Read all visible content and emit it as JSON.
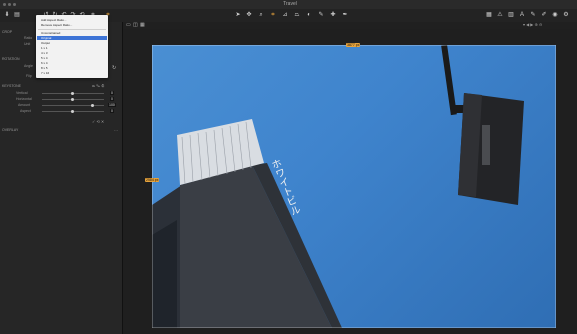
{
  "window": {
    "title": "Travel"
  },
  "aspect_menu": {
    "items_top": [
      "Add Aspect Ratio...",
      "Remove Aspect Ratio..."
    ],
    "items": [
      "Unconstrained",
      "Original",
      "Output",
      "1 x 1",
      "4 x 3",
      "5 x 4",
      "6 x 4",
      "8 x 5",
      "7 x 16"
    ],
    "selected": "Original"
  },
  "left_panel": {
    "crop_section": "CROP",
    "crop_rows": [
      "Ratio",
      "Unit"
    ],
    "rotation_section": "ROTATION",
    "rotation_rows": [
      "Angle",
      "Flip"
    ],
    "flip_value": "None",
    "keystone_section": "KEYSTONE",
    "keystone_rows": [
      "Vertical",
      "Horizontal",
      "Amount",
      "Aspect"
    ],
    "keystone_values": [
      "0",
      "0",
      "100",
      "0"
    ],
    "overlay_section": "OVERLAY"
  },
  "viewer": {
    "top_size_label": "3877 px",
    "left_size_label": "2584 px"
  },
  "photo_text": "ホワイトビル",
  "colors": {
    "accent": "#e7a33b",
    "menu_highlight": "#3d74d6",
    "sky": "#3f84cd"
  }
}
